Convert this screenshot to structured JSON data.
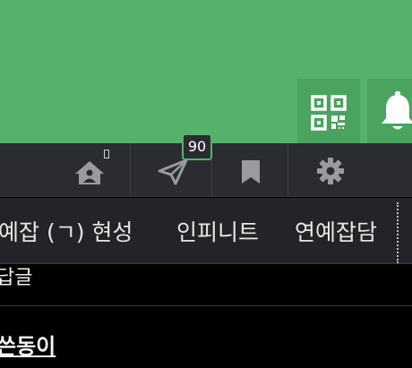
{
  "header": {
    "background": "#56b26b",
    "left_glyph": "·",
    "qr_button_icon": "qr-code-icon",
    "bell_button_icon": "bell-icon"
  },
  "toolbar": {
    "background": "#2b2c31",
    "items": [
      {
        "icon": "home-icon"
      },
      {
        "icon": "send-icon",
        "badge": "90"
      },
      {
        "icon": "bookmark-icon"
      },
      {
        "icon": "gear-icon"
      }
    ]
  },
  "tabs": {
    "items": [
      {
        "label": "예잡 (ㄱ) 현성"
      },
      {
        "label": "인피니트"
      },
      {
        "label": "연예잡담"
      }
    ]
  },
  "list": {
    "row1_text": "답글",
    "row2_text": "쓴동이"
  }
}
